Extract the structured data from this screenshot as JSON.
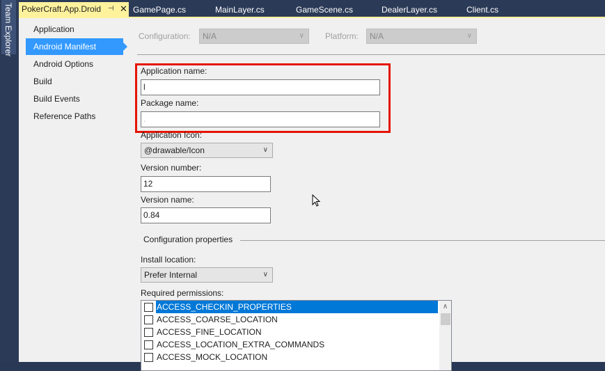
{
  "side_panel": {
    "label": "Team Explorer"
  },
  "tabs": [
    {
      "label": "PokerCraft.App.Droid",
      "active": true,
      "pin_icon": "pin-icon",
      "close_icon": "close-icon"
    },
    {
      "label": "GamePage.cs"
    },
    {
      "label": "MainLayer.cs"
    },
    {
      "label": "GameScene.cs"
    },
    {
      "label": "DealerLayer.cs"
    },
    {
      "label": "Client.cs"
    }
  ],
  "nav": {
    "items": [
      {
        "label": "Application"
      },
      {
        "label": "Android Manifest",
        "selected": true
      },
      {
        "label": "Android Options"
      },
      {
        "label": "Build"
      },
      {
        "label": "Build Events"
      },
      {
        "label": "Reference Paths"
      }
    ]
  },
  "toolbar": {
    "configuration_label": "Configuration:",
    "configuration_value": "N/A",
    "platform_label": "Platform:",
    "platform_value": "N/A"
  },
  "form": {
    "app_name_label": "Application name:",
    "app_name_value": "l",
    "package_name_label": "Package name:",
    "package_name_value": ".",
    "app_icon_label": "Application Icon:",
    "app_icon_value": "@drawable/Icon",
    "version_number_label": "Version number:",
    "version_number_value": "12",
    "version_name_label": "Version name:",
    "version_name_value": "0.84",
    "config_section_title": "Configuration properties",
    "install_location_label": "Install location:",
    "install_location_value": "Prefer Internal",
    "permissions_label": "Required permissions:",
    "permissions": [
      {
        "name": "ACCESS_CHECKIN_PROPERTIES",
        "checked": false,
        "selected": true
      },
      {
        "name": "ACCESS_COARSE_LOCATION",
        "checked": false
      },
      {
        "name": "ACCESS_FINE_LOCATION",
        "checked": false
      },
      {
        "name": "ACCESS_LOCATION_EXTRA_COMMANDS",
        "checked": false
      },
      {
        "name": "ACCESS_MOCK_LOCATION",
        "checked": false
      }
    ]
  },
  "colors": {
    "accent_tab": "#fff29d",
    "nav_selected": "#3399ff",
    "list_selected": "#0078d7",
    "highlight_box": "#e51400"
  }
}
